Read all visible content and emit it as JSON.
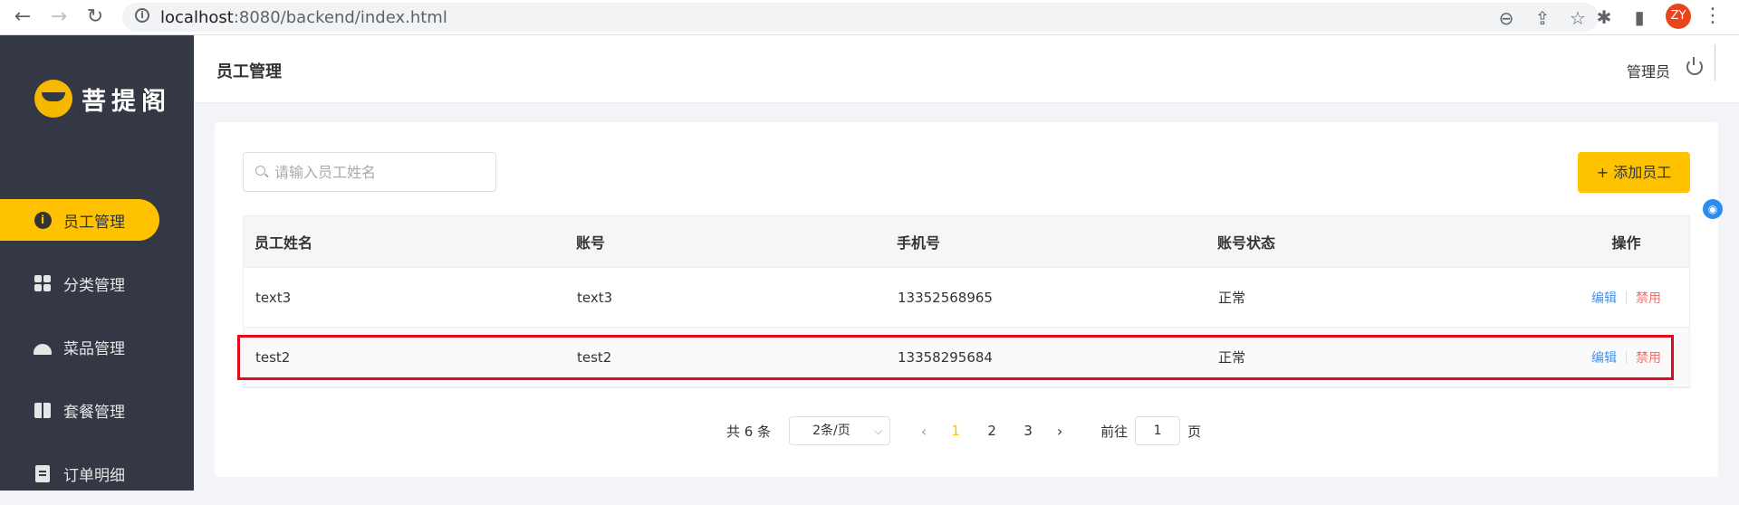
{
  "browser": {
    "url_host": "localhost",
    "url_path": ":8080/backend/index.html",
    "avatar_initials": "ZY"
  },
  "sidebar": {
    "logo_text": "菩提阁",
    "items": [
      {
        "label": "员工管理",
        "icon": "person-circle-icon",
        "active": true
      },
      {
        "label": "分类管理",
        "icon": "grid-icon",
        "active": false
      },
      {
        "label": "菜品管理",
        "icon": "dish-cover-icon",
        "active": false
      },
      {
        "label": "套餐管理",
        "icon": "gift-icon",
        "active": false
      },
      {
        "label": "订单明细",
        "icon": "clipboard-icon",
        "active": false
      }
    ]
  },
  "header": {
    "title": "员工管理",
    "user": "管理员"
  },
  "toolbar": {
    "search_placeholder": "请输入员工姓名",
    "add_label": "+ 添加员工"
  },
  "table": {
    "columns": [
      "员工姓名",
      "账号",
      "手机号",
      "账号状态",
      "操作"
    ],
    "rows": [
      {
        "name": "text3",
        "account": "text3",
        "phone": "13352568965",
        "status": "正常",
        "edit": "编辑",
        "disable": "禁用"
      },
      {
        "name": "test2",
        "account": "test2",
        "phone": "13358295684",
        "status": "正常",
        "edit": "编辑",
        "disable": "禁用"
      }
    ]
  },
  "pagination": {
    "total": "共 6 条",
    "page_size": "2条/页",
    "pages": [
      "1",
      "2",
      "3"
    ],
    "current": "1",
    "goto_label": "前往",
    "goto_value": "1",
    "goto_suffix": "页"
  },
  "colors": {
    "accent": "#ffc200",
    "sidebar_bg": "#343744",
    "highlight_border": "#e00b1d",
    "edit": "#4a90e2",
    "disable": "#f56c6c"
  }
}
